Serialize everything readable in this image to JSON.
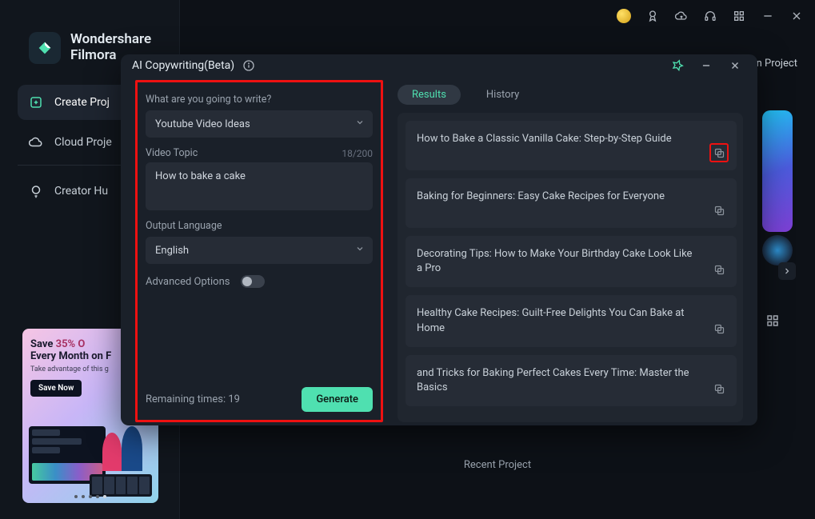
{
  "brand": {
    "line1": "Wondershare",
    "line2": "Filmora"
  },
  "sidebar": {
    "items": [
      {
        "label": "Create Proj"
      },
      {
        "label": "Cloud Proje"
      },
      {
        "label": "Creator Hu"
      }
    ]
  },
  "promo": {
    "line1_pre": "Save ",
    "line1_off": "35% O",
    "line2": "Every Month on F",
    "line3": "Take advantage of this g",
    "button": "Save Now"
  },
  "main": {
    "project_link": "en Project",
    "recent": "Recent Project"
  },
  "modal": {
    "title": "AI Copywriting(Beta)",
    "left": {
      "prompt_label": "What are you going to write?",
      "type_value": "Youtube Video Ideas",
      "topic_label": "Video Topic",
      "topic_count": "18/200",
      "topic_value": "How to bake a cake",
      "lang_label": "Output Language",
      "lang_value": "English",
      "advanced_label": "Advanced Options",
      "remaining": "Remaining times: 19",
      "generate": "Generate"
    },
    "tabs": {
      "results": "Results",
      "history": "History"
    },
    "results": [
      "How to Bake a Classic Vanilla Cake: Step-by-Step Guide",
      "Baking for Beginners: Easy Cake Recipes for Everyone",
      "Decorating Tips: How to Make Your Birthday Cake Look Like a Pro",
      "Healthy Cake Recipes: Guilt-Free Delights You Can Bake at Home",
      "and Tricks for Baking Perfect Cakes Every Time: Master the Basics"
    ]
  }
}
